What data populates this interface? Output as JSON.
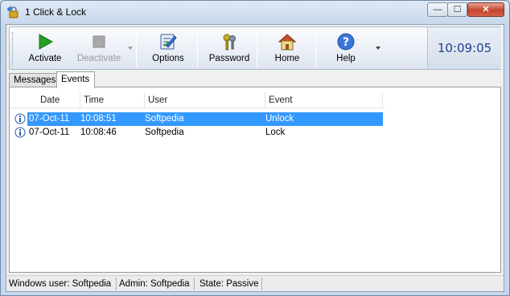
{
  "window": {
    "title": "1 Click & Lock"
  },
  "titlebar": {
    "minimize_glyph": "—",
    "maximize_glyph": "☐",
    "close_glyph": "✕"
  },
  "toolbar": {
    "activate_label": "Activate",
    "deactivate_label": "Deactivate",
    "options_label": "Options",
    "password_label": "Password",
    "home_label": "Home",
    "help_label": "Help",
    "clock": "10:09:05"
  },
  "tabs": [
    {
      "label": "Messages",
      "active": false
    },
    {
      "label": "Events",
      "active": true
    }
  ],
  "events": {
    "columns": [
      "Date",
      "Time",
      "User",
      "Event"
    ],
    "rows": [
      {
        "date": "07-Oct-11",
        "time": "10:08:51",
        "user": "Softpedia",
        "event": "Unlock",
        "selected": true
      },
      {
        "date": "07-Oct-11",
        "time": "10:08:46",
        "user": "Softpedia",
        "event": "Lock",
        "selected": false
      }
    ]
  },
  "statusbar": {
    "windows_user": "Windows user:  Softpedia",
    "admin": "Admin:  Softpedia",
    "state": "State:  Passive"
  },
  "icons": {
    "app": "padlock-icon",
    "activate": "play-icon",
    "deactivate": "stop-icon",
    "options": "options-icon",
    "password": "keys-icon",
    "home": "home-icon",
    "help": "help-icon",
    "event_row": "info-icon"
  },
  "colors": {
    "selection": "#3399ff",
    "clock_text": "#1d3f8a",
    "close_button": "#c7442c",
    "activate_green": "#22a022"
  }
}
